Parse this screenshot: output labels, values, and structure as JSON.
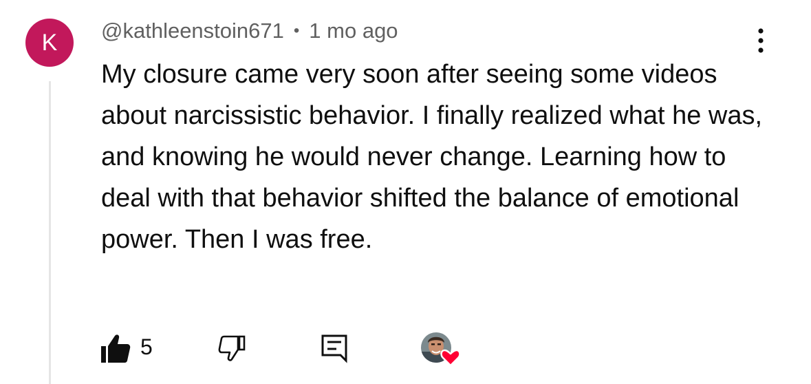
{
  "comment": {
    "avatar_letter": "K",
    "avatar_color": "#c2185b",
    "author": "@kathleenstoin671",
    "separator": "•",
    "timestamp": "1 mo ago",
    "text": "My closure came very soon after seeing some videos about narcissistic behavior. I finally realized what he was, and knowing he would never change. Learning how to deal with that behavior shifted the balance of emotional power. Then I was free.",
    "menu_icon": "more-vert-icon"
  },
  "actions": {
    "like_icon": "thumbs-up-filled-icon",
    "like_count": "5",
    "dislike_icon": "thumbs-down-icon",
    "reply_icon": "reply-comment-icon",
    "hearted_icon": "creator-heart-badge",
    "heart_color": "#ff0033"
  }
}
